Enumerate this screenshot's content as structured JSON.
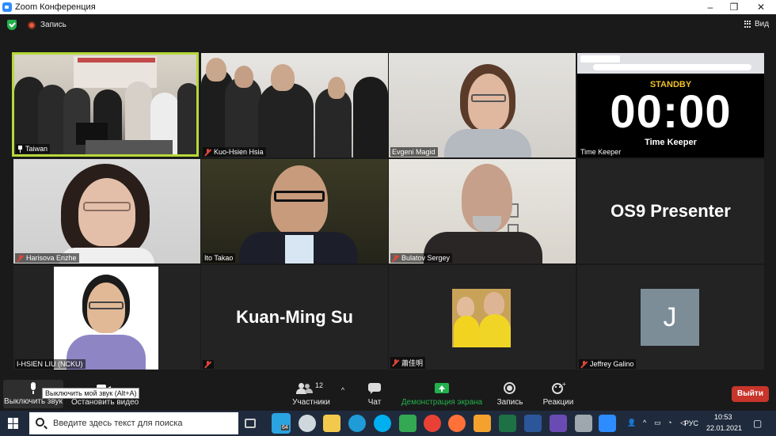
{
  "window": {
    "title": "Zoom Конференция",
    "minimize": "–",
    "restore": "❐",
    "close": "✕"
  },
  "topbar": {
    "record_label": "Запись",
    "view_label": "Вид"
  },
  "tiles": [
    {
      "name": "Taiwan"
    },
    {
      "name": "Kuo-Hsien Hsia"
    },
    {
      "name": "Evgeni Magid"
    },
    {
      "name": "Time Keeper",
      "standby": "STANDBY",
      "time": "00:00",
      "caption": "Time Keeper"
    },
    {
      "name": "Harisova Enzhe"
    },
    {
      "name": "Ito Takao"
    },
    {
      "name": "Bulatov Sergey"
    },
    {
      "name": "",
      "display": "OS9 Presenter"
    },
    {
      "name": "I-HSIEN LIU (NCKU)"
    },
    {
      "name": "",
      "display": "Kuan-Ming Su"
    },
    {
      "name": "蕭佳明"
    },
    {
      "name": "Jeffrey Galino",
      "avatar_letter": "J"
    }
  ],
  "toolbar": {
    "mute_label": "Выключить звук",
    "video_label": "Остановить видео",
    "tooltip": "Выключить мой звук (Alt+A)",
    "participants_label": "Участники",
    "participants_count": "12",
    "chat_label": "Чат",
    "share_label": "Демонстрация экрана",
    "record_label": "Запись",
    "reactions_label": "Реакции",
    "leave_label": "Выйти"
  },
  "taskbar": {
    "search_placeholder": "Введите здесь текст для поиска",
    "badge": "64",
    "language": "РУС",
    "time": "10:53",
    "date": "22.01.2021"
  },
  "colors": {
    "accent_green": "#23b14d",
    "active_speaker": "#b7d83a",
    "leave": "#c8352b",
    "share": "#23b14d"
  }
}
